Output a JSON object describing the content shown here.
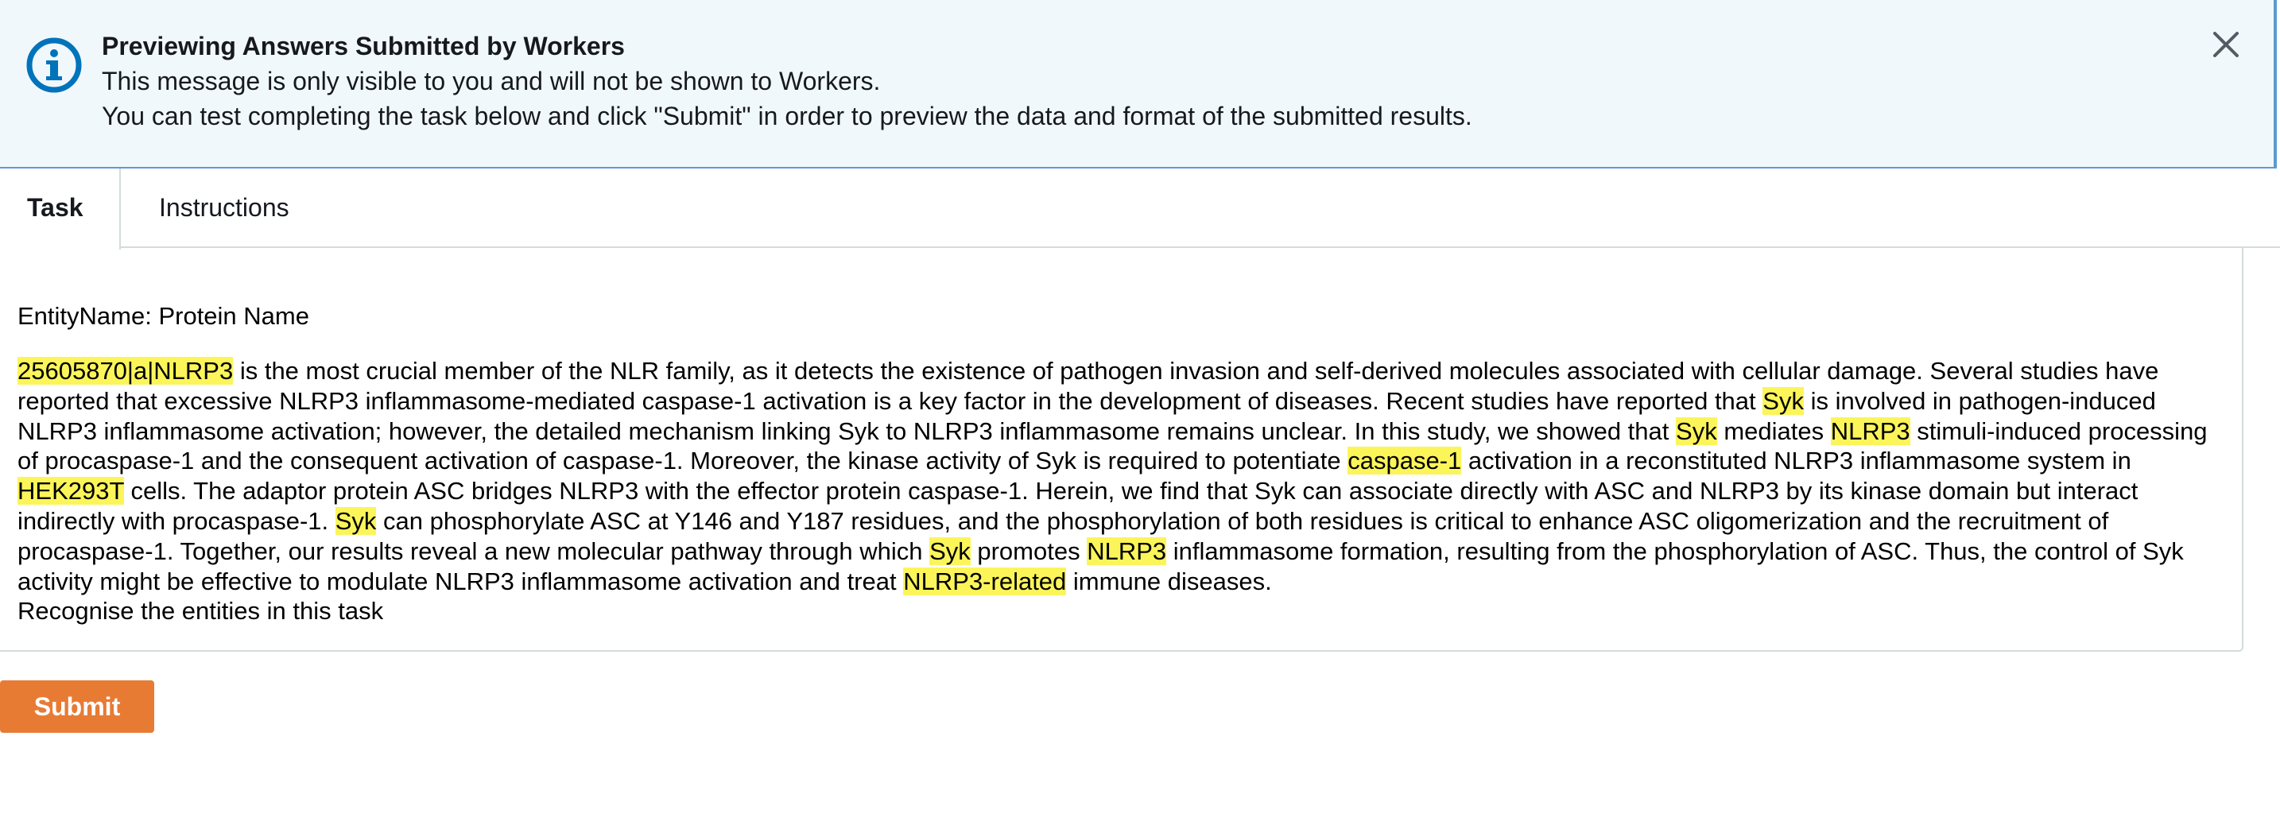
{
  "banner": {
    "icon": "info-icon",
    "title": "Previewing Answers Submitted by Workers",
    "line1": "This message is only visible to you and will not be shown to Workers.",
    "line2": "You can test completing the task below and click \"Submit\" in order to preview the data and format of the submitted results.",
    "close_icon": "close-icon",
    "accent_color": "#0073bb",
    "background_color": "#f1f8fb"
  },
  "tabs": [
    {
      "label": "Task",
      "active": true
    },
    {
      "label": "Instructions",
      "active": false
    }
  ],
  "task": {
    "entity_label": "EntityName: Protein Name",
    "highlight_color": "#fbf55a",
    "abstract": [
      {
        "text": "25605870|a|NLRP3",
        "highlight": true
      },
      {
        "text": " is the most crucial member of the NLR family, as it detects the existence of pathogen invasion and self-derived molecules associated with cellular damage. Several studies have reported that excessive NLRP3 inflammasome-mediated caspase-1 activation is a key factor in the development of diseases. Recent studies have reported that ",
        "highlight": false
      },
      {
        "text": "Syk",
        "highlight": true
      },
      {
        "text": " is involved in pathogen-induced NLRP3 inflammasome activation; however, the detailed mechanism linking Syk to NLRP3 inflammasome remains unclear. In this study, we showed that ",
        "highlight": false
      },
      {
        "text": "Syk",
        "highlight": true
      },
      {
        "text": " mediates ",
        "highlight": false
      },
      {
        "text": "NLRP3",
        "highlight": true
      },
      {
        "text": " stimuli-induced processing of procaspase-1 and the consequent activation of caspase-1. Moreover, the kinase activity of Syk is required to potentiate ",
        "highlight": false
      },
      {
        "text": "caspase-1",
        "highlight": true
      },
      {
        "text": " activation in a reconstituted NLRP3 inflammasome system in ",
        "highlight": false
      },
      {
        "text": "HEK293T",
        "highlight": true
      },
      {
        "text": " cells. The adaptor protein ASC bridges NLRP3 with the effector protein caspase-1. Herein, we find that Syk can associate directly with ASC and NLRP3 by its kinase domain but interact indirectly with procaspase-1. ",
        "highlight": false
      },
      {
        "text": "Syk",
        "highlight": true
      },
      {
        "text": " can phosphorylate ASC at Y146 and Y187 residues, and the phosphorylation of both residues is critical to enhance ASC oligomerization and the recruitment of procaspase-1. Together, our results reveal a new molecular pathway through which ",
        "highlight": false
      },
      {
        "text": "Syk",
        "highlight": true
      },
      {
        "text": " promotes ",
        "highlight": false
      },
      {
        "text": "NLRP3",
        "highlight": true
      },
      {
        "text": " inflammasome formation, resulting from the phosphorylation of ASC. Thus, the control of Syk activity might be effective to modulate NLRP3 inflammasome activation and treat ",
        "highlight": false
      },
      {
        "text": "NLRP3-related",
        "highlight": true
      },
      {
        "text": " immune diseases.",
        "highlight": false
      }
    ],
    "instruction": "Recognise the entities in this task"
  },
  "submit": {
    "label": "Submit",
    "color": "#e87b34"
  }
}
